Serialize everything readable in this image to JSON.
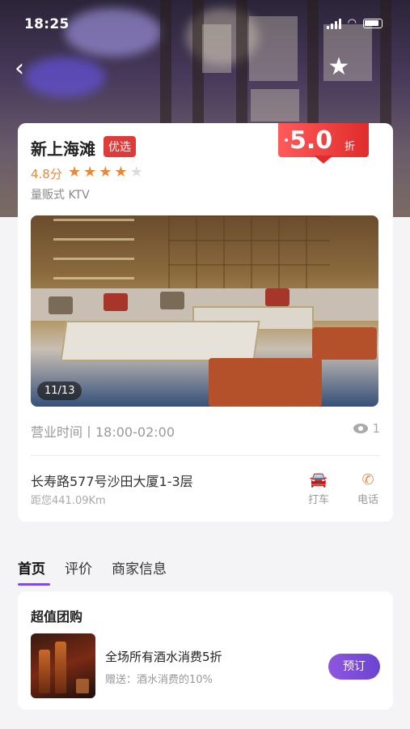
{
  "status_bar": {
    "time": "18:25"
  },
  "venue": {
    "name": "新上海滩",
    "tag": "优选",
    "discount_value": "5.0",
    "discount_unit": "折",
    "score": "4.8分",
    "rating_stars": 4,
    "rating_max": 5,
    "category": "量贩式 KTV",
    "photo_counter": "11/13",
    "hours": "营业时间丨18:00-02:00",
    "view_count": "1",
    "address": "长寿路577号沙田大厦1-3层",
    "distance": "距您441.09Km"
  },
  "actions": {
    "taxi_label": "打车",
    "phone_label": "电话"
  },
  "tabs": [
    {
      "label": "首页",
      "active": true
    },
    {
      "label": "评价",
      "active": false
    },
    {
      "label": "商家信息",
      "active": false
    }
  ],
  "deals": {
    "title": "超值团购",
    "items": [
      {
        "name": "全场所有酒水消费5折",
        "sub": "赠送：酒水消费的10%",
        "button": "预订"
      }
    ]
  },
  "colors": {
    "accent": "#7a4ee0",
    "discount": "#e02c2c",
    "star": "#e8893a",
    "tag": "#e03b3b"
  },
  "icons": {
    "back": "chevron-left-icon",
    "favorite": "star-icon",
    "taxi": "car-icon",
    "phone": "phone-icon",
    "views": "eye-icon"
  }
}
